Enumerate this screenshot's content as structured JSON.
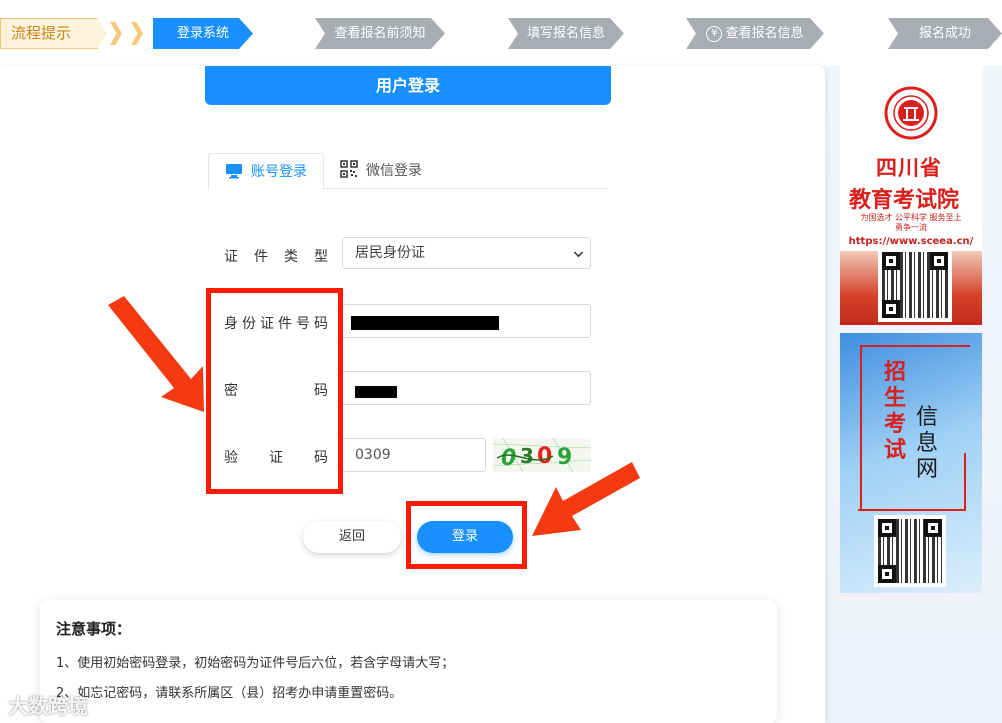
{
  "progress": {
    "label": "流程提示",
    "steps": [
      {
        "label": "登录系统",
        "state": "active"
      },
      {
        "label": "查看报名前须知",
        "state": "inactive"
      },
      {
        "label": "填写报名信息",
        "state": "inactive"
      },
      {
        "label": "查看报名信息",
        "state": "inactive",
        "icon": "yen-circle-icon"
      },
      {
        "label": "报名成功",
        "state": "inactive"
      }
    ]
  },
  "login": {
    "header": "用户登录",
    "tabs": [
      {
        "label": "账号登录",
        "icon": "monitor-icon",
        "active": true
      },
      {
        "label": "微信登录",
        "icon": "qr-code-icon",
        "active": false
      }
    ],
    "fields": {
      "id_type": {
        "label": "证件类型",
        "value": "居民身份证"
      },
      "id_number": {
        "label": "身份证件号码",
        "value": ""
      },
      "password": {
        "label": "密码",
        "value": ""
      },
      "captcha": {
        "label": "验证码",
        "value": "0309",
        "image_text": "0309"
      }
    },
    "buttons": {
      "back": "返回",
      "submit": "登录"
    }
  },
  "notes": {
    "title": "注意事项：",
    "lines": [
      "1、使用初始密码登录，初始密码为证件号后六位，若含字母请大写；",
      "2、如忘记密码，请联系所属区（县）招考办申请重置密码。"
    ]
  },
  "ads": {
    "ad1": {
      "title_line1": "四川省",
      "title_line2": "教育考试院",
      "slogan_line1": "为国选才  公平科学  服务至上",
      "slogan_line2": "勇争一流",
      "url": "https://www.sceea.cn/"
    },
    "ad2": {
      "title_col1": "招生考试",
      "title_col2": "信息网"
    }
  },
  "watermark": "大数跨境",
  "colors": {
    "primary": "#1890ff",
    "inactive_step": "#a9adb3",
    "annotation_red": "#ff1a00",
    "brand_red": "#d9201c"
  }
}
